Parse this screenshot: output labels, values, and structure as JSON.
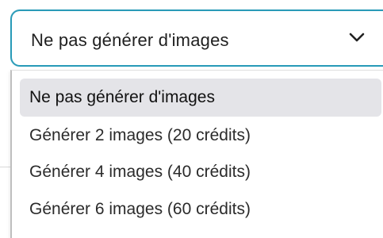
{
  "select": {
    "value": "Ne pas générer d'images",
    "icon": "chevron-down-icon",
    "border_color": "#2a9bb8"
  },
  "dropdown": {
    "options": [
      {
        "label": "Ne pas générer d'images",
        "selected": true
      },
      {
        "label": "Générer 2 images (20 crédits)",
        "selected": false
      },
      {
        "label": "Générer 4 images (40 crédits)",
        "selected": false
      },
      {
        "label": "Générer 6 images (60 crédits)",
        "selected": false
      }
    ],
    "highlight_color": "#e4e4e8"
  }
}
